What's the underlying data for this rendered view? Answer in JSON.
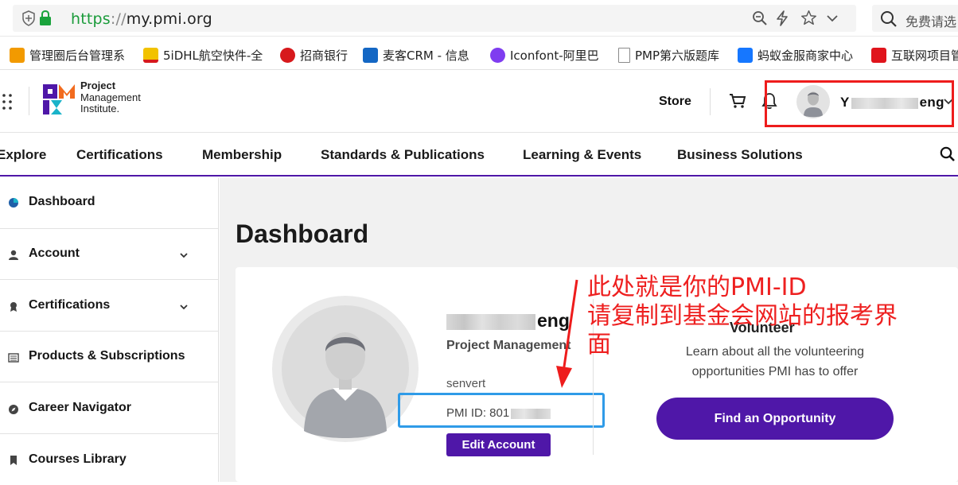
{
  "browser": {
    "url_protocol": "https",
    "url_separator": "://",
    "url_host": "my.pmi.org",
    "search_placeholder": "免费请选",
    "icons": [
      "shield-icon",
      "lock-icon",
      "zoom-icon",
      "lightning-icon",
      "star-icon",
      "chevron-down-icon",
      "search-icon"
    ]
  },
  "bookmarks": [
    {
      "label": "管理圈后台管理系",
      "color": "#f29a00"
    },
    {
      "label": "5iDHL航空快件-全",
      "color": "#f2c200"
    },
    {
      "label": "招商银行",
      "color": "#d7191c"
    },
    {
      "label": "麦客CRM - 信息",
      "color": "#1467c4"
    },
    {
      "label": "Iconfont-阿里巴",
      "color": "#7f3df0"
    },
    {
      "label": "PMP第六版题库",
      "color": "#8a8a8a"
    },
    {
      "label": "蚂蚁金服商家中心",
      "color": "#1677ff"
    },
    {
      "label": "互联网项目管",
      "color": "#e0141c"
    }
  ],
  "header": {
    "logo_line1": "Project",
    "logo_line2": "Management",
    "logo_line3": "Institute.",
    "store_label": "Store",
    "user_name_prefix": "Y",
    "user_name_suffix": "eng",
    "colors": {
      "brand_purple": "#4f17a8",
      "pmi_teal": "#1ab3c9",
      "pmi_orange": "#f26b1e"
    }
  },
  "nav": {
    "items": [
      "Explore",
      "Certifications",
      "Membership",
      "Standards & Publications",
      "Learning & Events",
      "Business Solutions"
    ]
  },
  "sidebar": {
    "items": [
      {
        "label": "Dashboard",
        "icon": "dashboard-icon",
        "has_chevron": false
      },
      {
        "label": "Account",
        "icon": "user-icon",
        "has_chevron": true
      },
      {
        "label": "Certifications",
        "icon": "award-icon",
        "has_chevron": true
      },
      {
        "label": "Products & Subscriptions",
        "icon": "list-icon",
        "has_chevron": false
      },
      {
        "label": "Career Navigator",
        "icon": "compass-icon",
        "has_chevron": false
      },
      {
        "label": "Courses Library",
        "icon": "bookmark-icon",
        "has_chevron": false
      }
    ]
  },
  "main": {
    "title": "Dashboard",
    "profile": {
      "name_suffix": "eng",
      "org": "Project Management",
      "username": "senvert",
      "pmi_id_label": "PMI ID: 801",
      "edit_button": "Edit Account"
    },
    "volunteer": {
      "title": "Volunteer",
      "desc_line1": "Learn about all the volunteering",
      "desc_line2": "opportunities PMI has to offer",
      "button": "Find an Opportunity"
    }
  },
  "annotation": {
    "line1": "此处就是你的PMI-ID",
    "line2": "请复制到基金会网站的报考界",
    "line3": "面",
    "color": "#ee2020"
  }
}
